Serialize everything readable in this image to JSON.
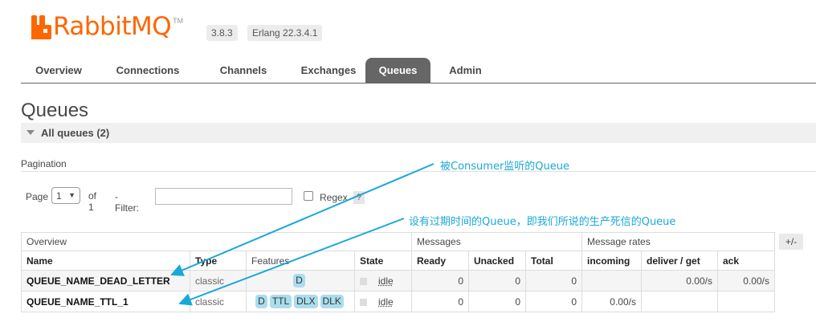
{
  "app": {
    "logo_text": "RabbitMQ",
    "logo_tm": "TM",
    "version": "3.8.3",
    "erlang": "Erlang 22.3.4.1",
    "brand_color": "#ff6600"
  },
  "nav": {
    "tabs": [
      {
        "label": "Overview"
      },
      {
        "label": "Connections"
      },
      {
        "label": "Channels"
      },
      {
        "label": "Exchanges"
      },
      {
        "label": "Queues"
      },
      {
        "label": "Admin"
      }
    ],
    "active": "Queues"
  },
  "page": {
    "title": "Queues",
    "section_title": "All queues (2)"
  },
  "pagination": {
    "label": "Pagination",
    "page_label": "Page",
    "page_value": "1",
    "of_label": "of 1",
    "filter_label": "- Filter:",
    "filter_value": "",
    "regex_label": "Regex",
    "help_label": "?"
  },
  "table": {
    "groups": [
      "Overview",
      "Messages",
      "Message rates"
    ],
    "columns": [
      "Name",
      "Type",
      "Features",
      "State",
      "Ready",
      "Unacked",
      "Total",
      "incoming",
      "deliver / get",
      "ack"
    ],
    "toggle_label": "+/-",
    "rows": [
      {
        "name": "QUEUE_NAME_DEAD_LETTER",
        "type": "classic",
        "features": [
          "D"
        ],
        "state": "idle",
        "ready": "0",
        "unacked": "0",
        "total": "0",
        "incoming": "",
        "deliver_get": "0.00/s",
        "ack": "0.00/s"
      },
      {
        "name": "QUEUE_NAME_TTL_1",
        "type": "classic",
        "features": [
          "D",
          "TTL",
          "DLX",
          "DLK"
        ],
        "state": "idle",
        "ready": "0",
        "unacked": "0",
        "total": "0",
        "incoming": "0.00/s",
        "deliver_get": "",
        "ack": ""
      }
    ]
  },
  "annotations": {
    "note1": "被Consumer监听的Queue",
    "note2": "设有过期时间的Queue，即我们所说的生产死信的Queue",
    "color": "#1aa8d8"
  }
}
